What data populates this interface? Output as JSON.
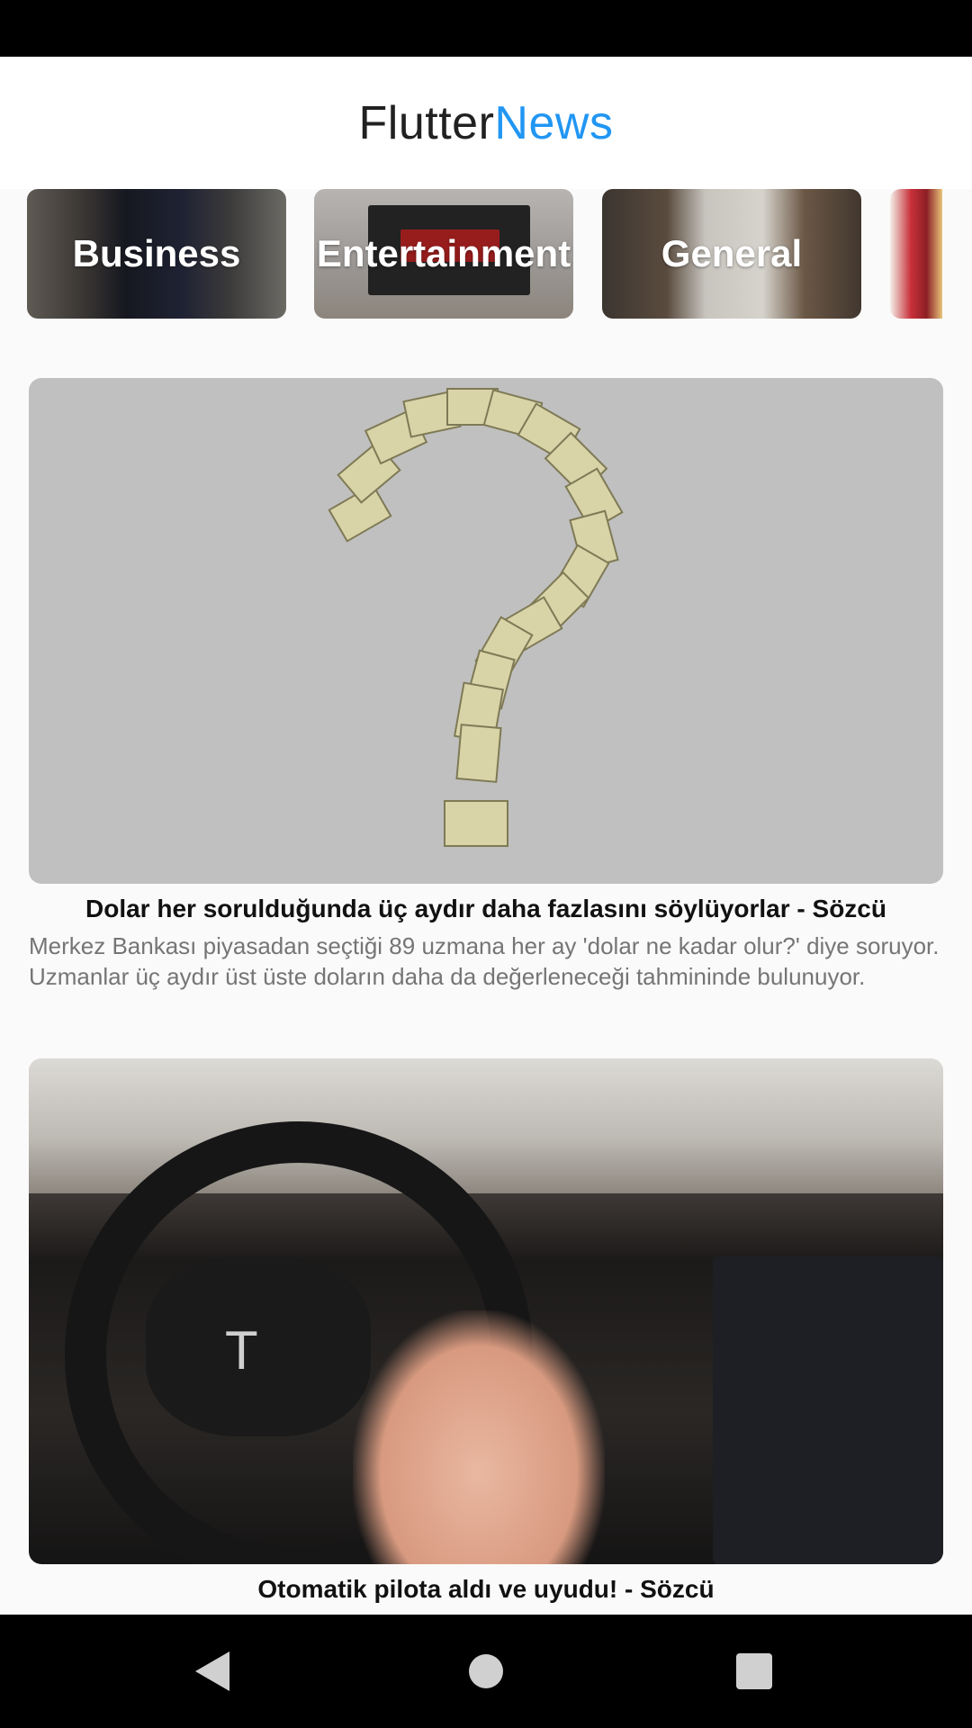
{
  "app": {
    "title_part1": "Flutter",
    "title_part2": "News",
    "accent_color": "#2196f3"
  },
  "categories": [
    {
      "label": "Business"
    },
    {
      "label": "Entertainment"
    },
    {
      "label": "General"
    },
    {
      "label": ""
    }
  ],
  "articles": [
    {
      "title": "Dolar her sorulduğunda üç aydır daha fazlasını söylüyorlar - Sözcü",
      "description": "Merkez Bankası piyasadan seçtiği 89 uzmana her ay 'dolar ne kadar olur?' diye soruyor. Uzmanlar üç aydır üst üste doların daha da değerleneceği tahmininde bulunuyor."
    },
    {
      "title": "Otomatik pilota aldı ve uyudu! - Sözcü",
      "description": ""
    }
  ],
  "navigation": {
    "back_icon": "triangle-back-icon",
    "home_icon": "circle-home-icon",
    "recents_icon": "square-recents-icon"
  }
}
